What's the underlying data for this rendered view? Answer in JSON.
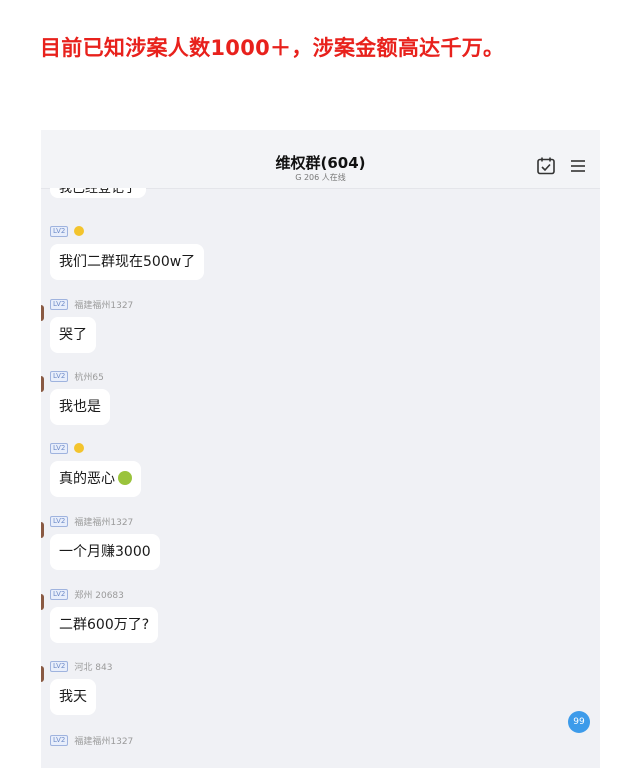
{
  "headline": "目前已知涉案人数1000＋，涉案金额高达千万。",
  "chat": {
    "title": "维权群(604)",
    "subtitle": "G 206 人在线",
    "unread_badge": "99",
    "top_partial_message": "我已经登记了",
    "messages": [
      {
        "level": "LV2",
        "nickname": "",
        "emoji": "sad-face",
        "text": "我们二群现在500w了"
      },
      {
        "level": "LV2",
        "nickname": "福建福州1327",
        "text": "哭了"
      },
      {
        "level": "LV2",
        "nickname": "杭州65",
        "text": "我也是"
      },
      {
        "level": "LV2",
        "nickname": "",
        "emoji": "sad-face",
        "text": "真的恶心",
        "trailing_emoji": "green-face"
      },
      {
        "level": "LV2",
        "nickname": "福建福州1327",
        "text": "一个月赚3000"
      },
      {
        "level": "LV2",
        "nickname": "郑州 20683",
        "text": "二群600万了?"
      },
      {
        "level": "LV2",
        "nickname": "河北 843",
        "text": "我天"
      },
      {
        "level": "LV2",
        "nickname": "福建福州1327",
        "text": ""
      }
    ]
  },
  "icons": {
    "calendar": "calendar-check-icon",
    "menu": "hamburger-menu-icon"
  },
  "colors": {
    "headline": "#e8211c",
    "chat_bg": "#f0f1f5",
    "bubble": "#ffffff",
    "badge": "#3d9bea"
  }
}
